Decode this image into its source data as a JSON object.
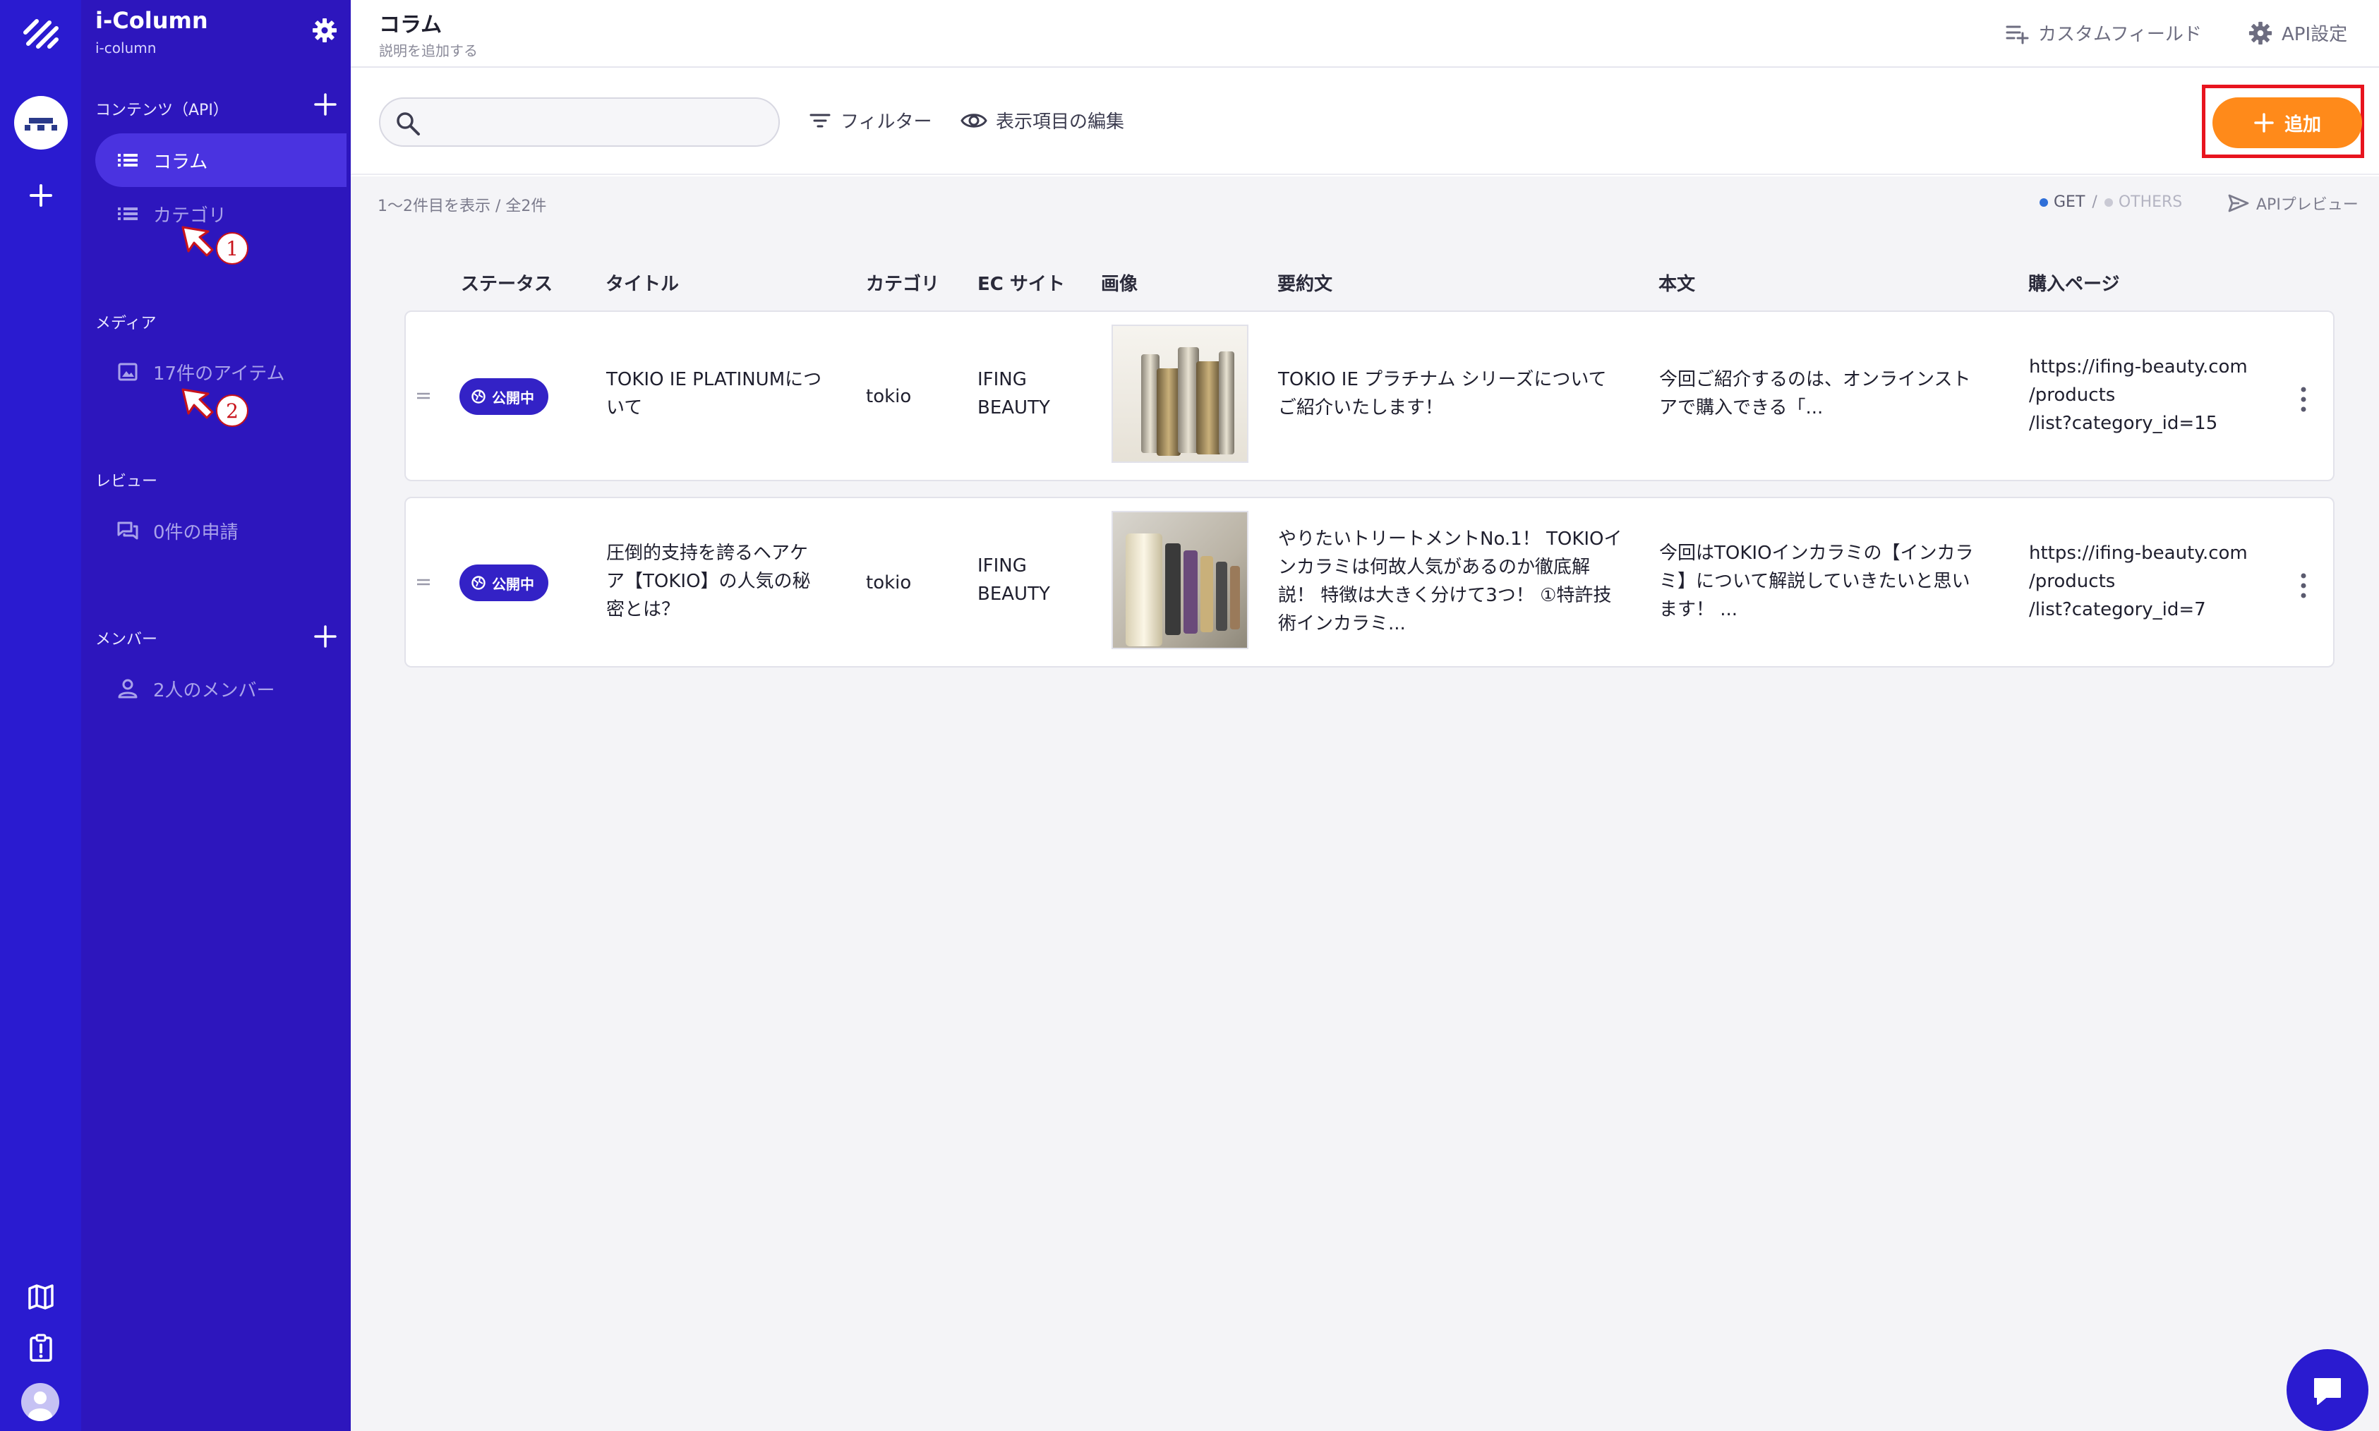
{
  "app": {
    "name": "i-Column",
    "subtitle": "i-column"
  },
  "sidebar": {
    "contents_title": "コンテンツ（API）",
    "contents_items": [
      {
        "label": "コラム",
        "icon": "list-icon",
        "active": true
      },
      {
        "label": "カテゴリ",
        "icon": "list-icon",
        "active": false
      }
    ],
    "media_title": "メディア",
    "media_item": {
      "label": "17件のアイテム",
      "icon": "image-icon"
    },
    "review_title": "レビュー",
    "review_item": {
      "label": "0件の申請",
      "icon": "chat-icon"
    },
    "members_title": "メンバー",
    "members_item": {
      "label": "2人のメンバー",
      "icon": "person-icon"
    },
    "annotations": [
      "1",
      "2"
    ]
  },
  "header": {
    "title": "コラム",
    "description": "説明を追加する",
    "custom_field_label": "カスタムフィールド",
    "api_settings_label": "API設定"
  },
  "toolbar": {
    "search_placeholder": "",
    "filter_label": "フィルター",
    "edit_columns_label": "表示項目の編集",
    "add_label": "追加"
  },
  "list": {
    "count_text": "1〜2件目を表示 / 全2件",
    "get_label": "GET",
    "separator": "/",
    "others_label": "OTHERS",
    "api_preview_label": "APIプレビュー",
    "columns": [
      "ステータス",
      "タイトル",
      "カテゴリ",
      "EC サイト",
      "画像",
      "要約文",
      "本文",
      "購入ページ"
    ],
    "rows": [
      {
        "status": "公開中",
        "title_lines": [
          "TOKIO IE PLATINUMにつ",
          "いて"
        ],
        "category": "tokio",
        "ec_lines": [
          "IFING",
          "BEAUTY"
        ],
        "summary_lines": [
          "TOKIO IE プラチナム シリーズについて",
          "ご紹介いたします！"
        ],
        "body_lines": [
          "今回ご紹介するのは、オンラインスト",
          "アで購入できる「..."
        ],
        "purchase_lines": [
          "https://ifing-beauty.com",
          "/products",
          "/list?category_id=15"
        ]
      },
      {
        "status": "公開中",
        "title_lines": [
          "圧倒的支持を誇るヘアケ",
          "ア【TOKIO】の人気の秘",
          "密とは？"
        ],
        "category": "tokio",
        "ec_lines": [
          "IFING",
          "BEAUTY"
        ],
        "summary_lines": [
          "やりたいトリートメントNo.1！ TOKIOイ",
          "ンカラミは何故人気があるのか徹底解",
          "説！ 特徴は大きく分けて3つ！ ①特許技",
          "術インカラミ..."
        ],
        "body_lines": [
          "今回はTOKIOインカラミの【インカラ",
          "ミ】について解説していきたいと思い",
          "ます！ ..."
        ],
        "purchase_lines": [
          "https://ifing-beauty.com",
          "/products",
          "/list?category_id=7"
        ]
      }
    ]
  },
  "colors": {
    "rail": "#2a1bd0",
    "sidebar": "#2d16bd",
    "accent": "#ff8a1a",
    "status_badge": "#3322c6",
    "highlight_border": "#e8141e",
    "get_dot": "#2f6fd8"
  }
}
